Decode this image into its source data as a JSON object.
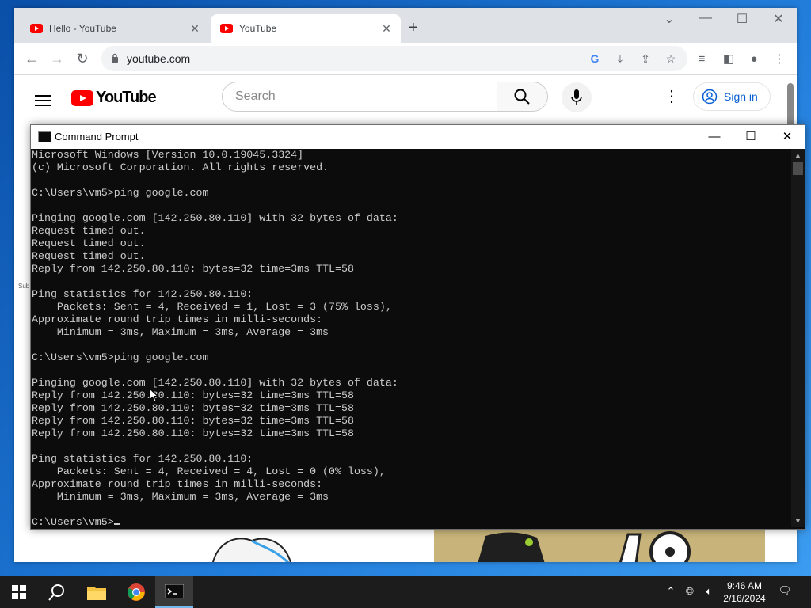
{
  "browser": {
    "tabs": [
      {
        "title": "Hello - YouTube",
        "active": false
      },
      {
        "title": "YouTube",
        "active": true
      }
    ],
    "url": "youtube.com"
  },
  "youtube": {
    "logo_text": "YouTube",
    "search_placeholder": "Search",
    "signin_label": "Sign in",
    "sidebar_partial_text": "Sub"
  },
  "cmd": {
    "title": "Command Prompt",
    "lines": [
      "Microsoft Windows [Version 10.0.19045.3324]",
      "(c) Microsoft Corporation. All rights reserved.",
      "",
      "C:\\Users\\vm5>ping google.com",
      "",
      "Pinging google.com [142.250.80.110] with 32 bytes of data:",
      "Request timed out.",
      "Request timed out.",
      "Request timed out.",
      "Reply from 142.250.80.110: bytes=32 time=3ms TTL=58",
      "",
      "Ping statistics for 142.250.80.110:",
      "    Packets: Sent = 4, Received = 1, Lost = 3 (75% loss),",
      "Approximate round trip times in milli-seconds:",
      "    Minimum = 3ms, Maximum = 3ms, Average = 3ms",
      "",
      "C:\\Users\\vm5>ping google.com",
      "",
      "Pinging google.com [142.250.80.110] with 32 bytes of data:",
      "Reply from 142.250.80.110: bytes=32 time=3ms TTL=58",
      "Reply from 142.250.80.110: bytes=32 time=3ms TTL=58",
      "Reply from 142.250.80.110: bytes=32 time=3ms TTL=58",
      "Reply from 142.250.80.110: bytes=32 time=3ms TTL=58",
      "",
      "Ping statistics for 142.250.80.110:",
      "    Packets: Sent = 4, Received = 4, Lost = 0 (0% loss),",
      "Approximate round trip times in milli-seconds:",
      "    Minimum = 3ms, Maximum = 3ms, Average = 3ms",
      ""
    ],
    "prompt": "C:\\Users\\vm5>"
  },
  "taskbar": {
    "apps": [
      "start-icon",
      "search-icon",
      "file-explorer-icon",
      "chrome-icon",
      "command-prompt-icon"
    ],
    "time": "9:46 AM",
    "date": "2/16/2024"
  },
  "colors": {
    "youtube_red": "#ff0000",
    "signin_blue": "#065fd4",
    "console_bg": "#0c0c0c",
    "console_text": "#cccccc",
    "taskbar": "#1c1c1c"
  }
}
